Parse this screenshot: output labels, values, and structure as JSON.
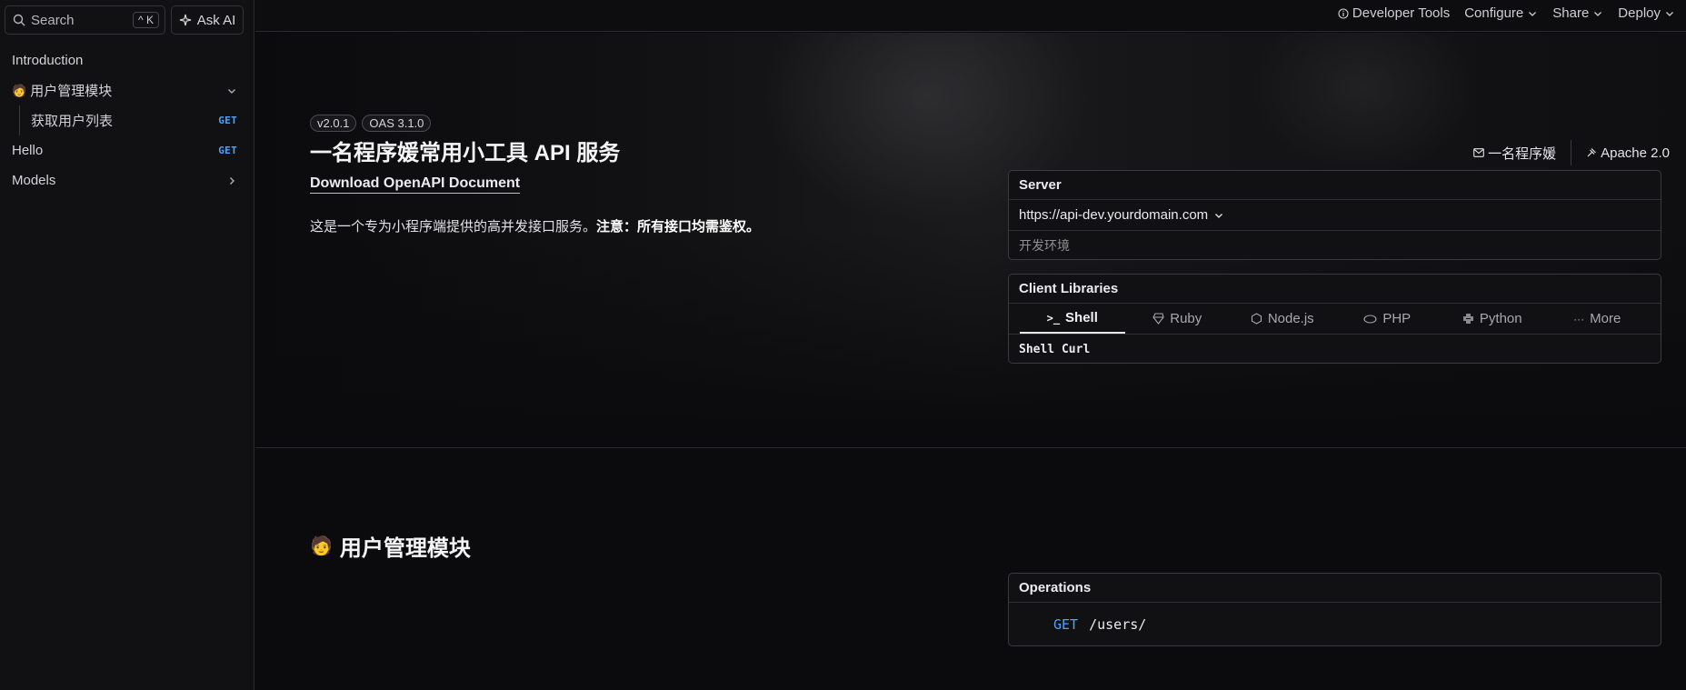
{
  "sidebar": {
    "search_label": "Search",
    "search_shortcut": "^ K",
    "ask_ai_label": "Ask AI",
    "items": [
      {
        "label": "Introduction"
      },
      {
        "label": "用户管理模块"
      },
      {
        "label": "获取用户列表",
        "badge": "GET"
      },
      {
        "label": "Hello",
        "badge": "GET"
      },
      {
        "label": "Models"
      }
    ]
  },
  "topbar": {
    "developer_tools": "Developer Tools",
    "configure": "Configure",
    "share": "Share",
    "deploy": "Deploy"
  },
  "hero": {
    "version_badge": "v2.0.1",
    "oas_badge": "OAS 3.1.0",
    "title": "一名程序媛常用小工具 API 服务",
    "download_label": "Download OpenAPI Document",
    "description_plain": "这是一个专为小程序端提供的高并发接口服务。",
    "description_bold": "注意：所有接口均需鉴权。",
    "contact_label": "一名程序媛",
    "license_label": "Apache 2.0"
  },
  "server": {
    "heading": "Server",
    "url": "https://api-dev.yourdomain.com",
    "environment": "开发环境"
  },
  "client_libraries": {
    "heading": "Client Libraries",
    "tabs": [
      {
        "label": "Shell",
        "icon": "terminal-icon",
        "active": true
      },
      {
        "label": "Ruby",
        "icon": "ruby-icon"
      },
      {
        "label": "Node.js",
        "icon": "nodejs-icon"
      },
      {
        "label": "PHP",
        "icon": "php-icon"
      },
      {
        "label": "Python",
        "icon": "python-icon"
      },
      {
        "label": "More",
        "icon": "ellipsis-icon"
      }
    ],
    "code_label": "Shell Curl"
  },
  "section": {
    "title": "用户管理模块"
  },
  "operations": {
    "heading": "Operations",
    "rows": [
      {
        "method": "GET",
        "path": "/users/"
      }
    ]
  },
  "colors": {
    "background": "#0b0b0d",
    "accent_get": "#4aa3ff",
    "border": "#3a3a40"
  }
}
